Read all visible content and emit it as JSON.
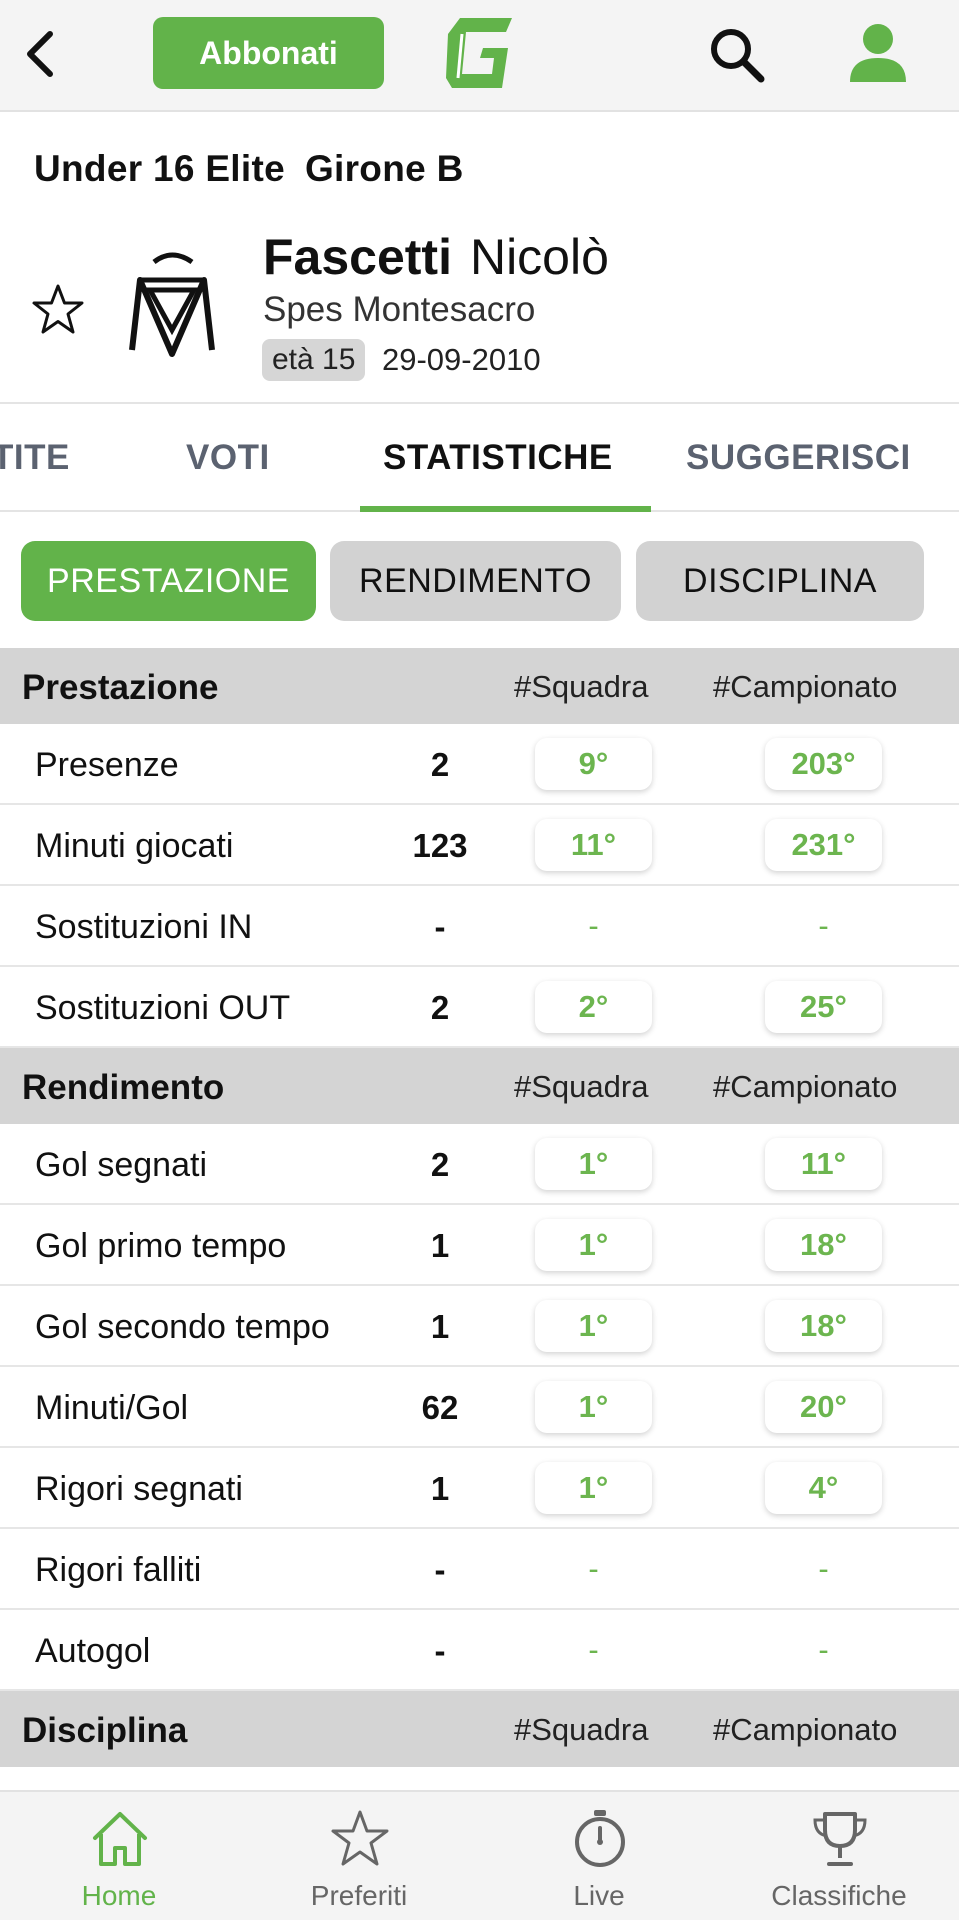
{
  "topbar": {
    "subscribe_label": "Abbonati"
  },
  "header": {
    "competition": "Under 16 Elite",
    "group": "Girone B",
    "surname": "Fascetti",
    "firstname": "Nicolò",
    "team": "Spes Montesacro",
    "age": "età 15",
    "birth_date": "29-09-2010"
  },
  "tabs": [
    {
      "label": "TITE"
    },
    {
      "label": "VOTI"
    },
    {
      "label": "STATISTICHE"
    },
    {
      "label": "SUGGERISCI"
    }
  ],
  "active_tab": "STATISTICHE",
  "segments": [
    {
      "label": "PRESTAZIONE"
    },
    {
      "label": "RENDIMENTO"
    },
    {
      "label": "DISCIPLINA"
    }
  ],
  "active_segment": "PRESTAZIONE",
  "columns": {
    "team": "#Squadra",
    "league": "#Campionato"
  },
  "sections": [
    {
      "title": "Prestazione",
      "rows": [
        {
          "label": "Presenze",
          "value": "2",
          "team": "9°",
          "league": "203°"
        },
        {
          "label": "Minuti giocati",
          "value": "123",
          "team": "11°",
          "league": "231°"
        },
        {
          "label": "Sostituzioni IN",
          "value": "-",
          "team": "-",
          "league": "-"
        },
        {
          "label": "Sostituzioni OUT",
          "value": "2",
          "team": "2°",
          "league": "25°"
        }
      ]
    },
    {
      "title": "Rendimento",
      "rows": [
        {
          "label": "Gol segnati",
          "value": "2",
          "team": "1°",
          "league": "11°"
        },
        {
          "label": "Gol primo tempo",
          "value": "1",
          "team": "1°",
          "league": "18°"
        },
        {
          "label": "Gol secondo tempo",
          "value": "1",
          "team": "1°",
          "league": "18°"
        },
        {
          "label": "Minuti/Gol",
          "value": "62",
          "team": "1°",
          "league": "20°"
        },
        {
          "label": "Rigori segnati",
          "value": "1",
          "team": "1°",
          "league": "4°"
        },
        {
          "label": "Rigori falliti",
          "value": "-",
          "team": "-",
          "league": "-"
        },
        {
          "label": "Autogol",
          "value": "-",
          "team": "-",
          "league": "-"
        }
      ]
    },
    {
      "title": "Disciplina",
      "rows": []
    }
  ],
  "bottom_nav": [
    {
      "label": "Home",
      "icon": "home-icon"
    },
    {
      "label": "Preferiti",
      "icon": "star-icon"
    },
    {
      "label": "Live",
      "icon": "stopwatch-icon"
    },
    {
      "label": "Classifiche",
      "icon": "trophy-icon"
    }
  ],
  "active_nav": "Home",
  "colors": {
    "accent": "#62b34a",
    "rank_text": "#6cb54f",
    "section_bg": "#d4d4d4"
  }
}
